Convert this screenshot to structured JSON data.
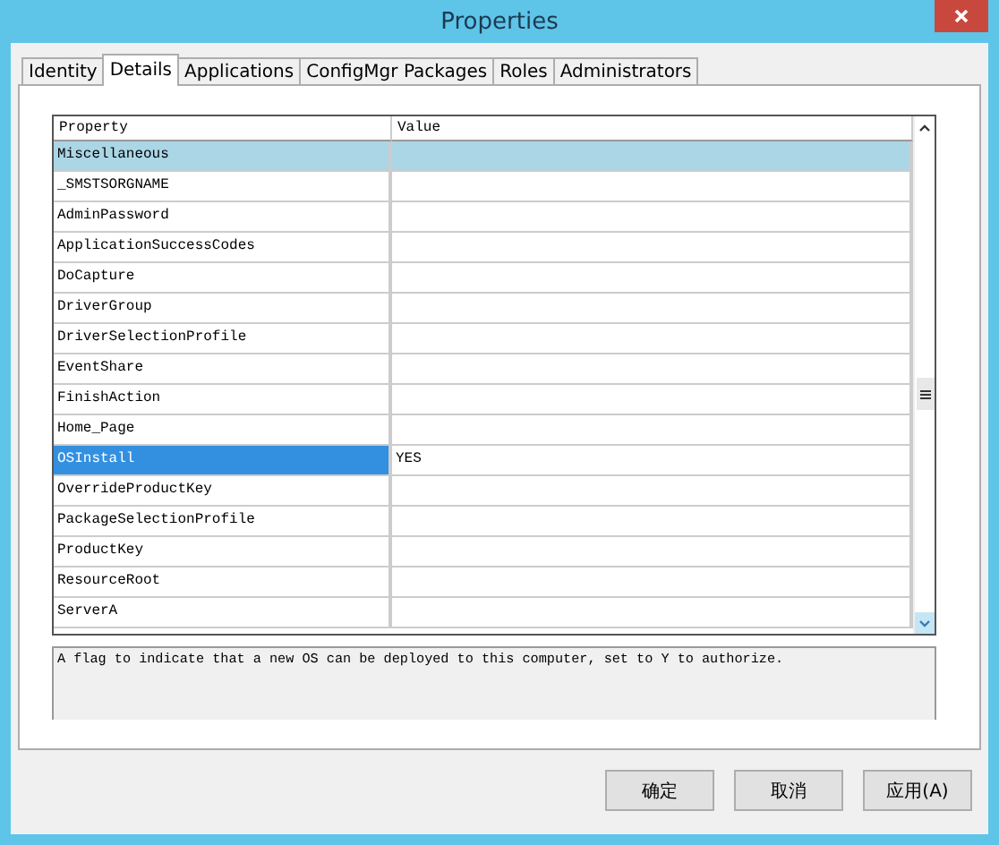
{
  "window": {
    "title": "Properties"
  },
  "tabs": [
    {
      "label": "Identity",
      "selected": false
    },
    {
      "label": "Details",
      "selected": true
    },
    {
      "label": "Applications",
      "selected": false
    },
    {
      "label": "ConfigMgr Packages",
      "selected": false
    },
    {
      "label": "Roles",
      "selected": false
    },
    {
      "label": "Administrators",
      "selected": false
    }
  ],
  "table": {
    "columns": [
      "Property",
      "Value"
    ],
    "rows": [
      {
        "kind": "category",
        "property": "Miscellaneous",
        "value": "",
        "selected": false
      },
      {
        "kind": "property",
        "property": "_SMSTSORGNAME",
        "value": "",
        "selected": false
      },
      {
        "kind": "property",
        "property": "AdminPassword",
        "value": "",
        "selected": false
      },
      {
        "kind": "property",
        "property": "ApplicationSuccessCodes",
        "value": "",
        "selected": false
      },
      {
        "kind": "property",
        "property": "DoCapture",
        "value": "",
        "selected": false
      },
      {
        "kind": "property",
        "property": "DriverGroup",
        "value": "",
        "selected": false
      },
      {
        "kind": "property",
        "property": "DriverSelectionProfile",
        "value": "",
        "selected": false
      },
      {
        "kind": "property",
        "property": "EventShare",
        "value": "",
        "selected": false
      },
      {
        "kind": "property",
        "property": "FinishAction",
        "value": "",
        "selected": false
      },
      {
        "kind": "property",
        "property": "Home_Page",
        "value": "",
        "selected": false
      },
      {
        "kind": "property",
        "property": "OSInstall",
        "value": "YES",
        "selected": true
      },
      {
        "kind": "property",
        "property": "OverrideProductKey",
        "value": "",
        "selected": false
      },
      {
        "kind": "property",
        "property": "PackageSelectionProfile",
        "value": "",
        "selected": false
      },
      {
        "kind": "property",
        "property": "ProductKey",
        "value": "",
        "selected": false
      },
      {
        "kind": "property",
        "property": "ResourceRoot",
        "value": "",
        "selected": false
      },
      {
        "kind": "property",
        "property": "ServerA",
        "value": "",
        "selected": false
      }
    ]
  },
  "description": "A flag to indicate that a new OS can be deployed to this computer, set to Y to authorize.",
  "buttons": [
    "确定",
    "取消",
    "应用(A)"
  ]
}
